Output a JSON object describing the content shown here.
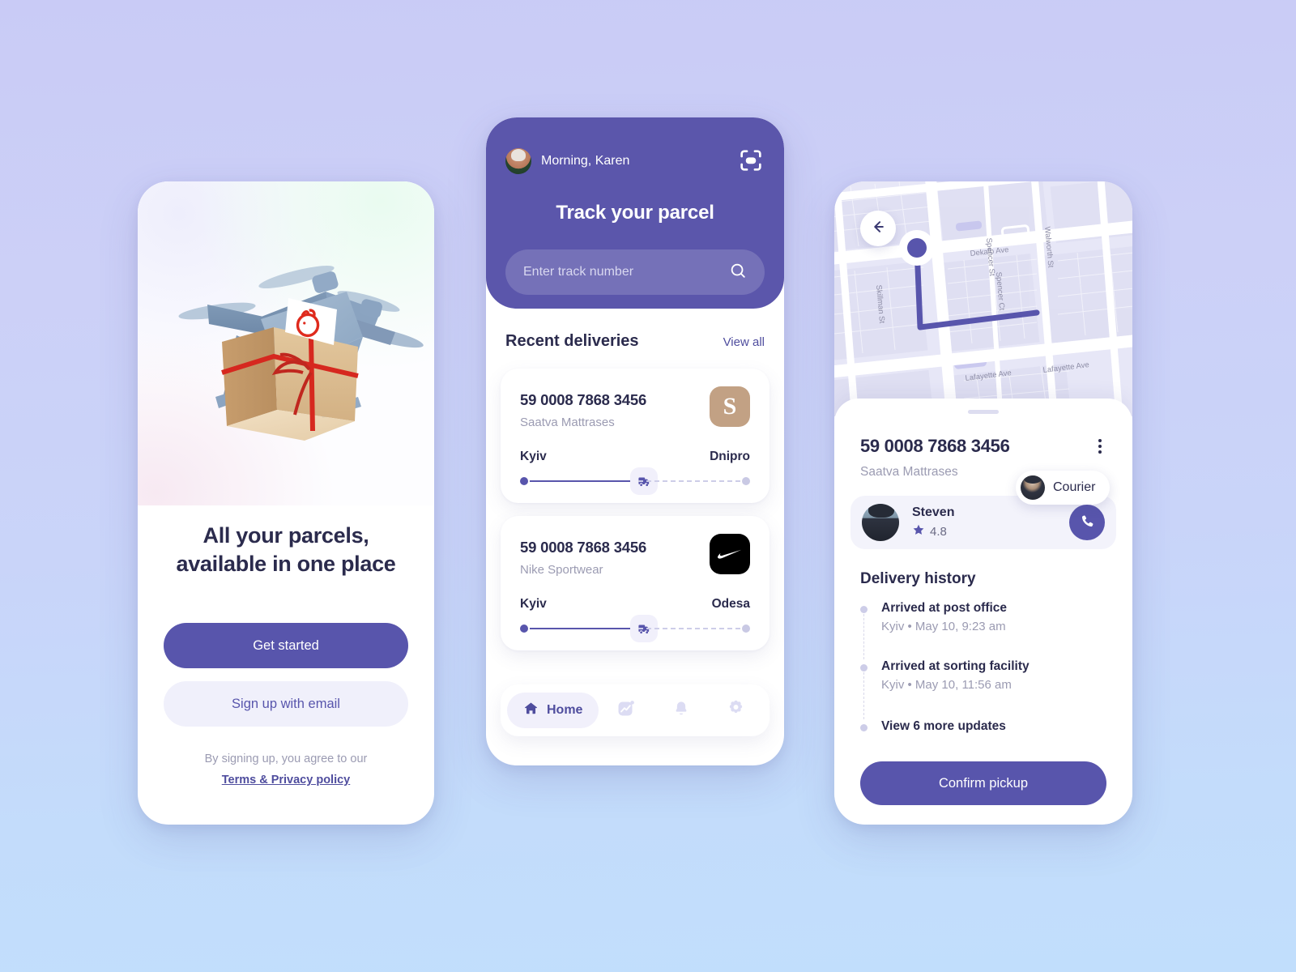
{
  "theme": {
    "accent": "#5855ac",
    "accent_dark": "#4f4d9e",
    "text_dark": "#2b2b4d",
    "text_muted": "#9b9bb2",
    "surface": "#ffffff",
    "surface_tint": "#f1f0fb",
    "bg_top": "#c9cbf6",
    "bg_bottom": "#c1defc"
  },
  "onboarding": {
    "illustration": "drone-carrying-parcel-illustration",
    "title_line1": "All your parcels,",
    "title_line2": "available in one place",
    "primary_button": "Get started",
    "secondary_button": "Sign up with email",
    "legal_prefix": "By signing up, you agree to our",
    "legal_link": "Terms & Privacy policy"
  },
  "home": {
    "greeting": "Morning, Karen",
    "avatar": "user-avatar-karen",
    "scan_icon": "scan-icon",
    "heading": "Track your parcel",
    "search": {
      "placeholder": "Enter track number",
      "value": "",
      "icon": "search-icon"
    },
    "section_title": "Recent deliveries",
    "view_all": "View all",
    "deliveries": [
      {
        "tracking_number": "59 0008 7868 3456",
        "merchant": "Saatva Mattrases",
        "logo_text": "S",
        "logo_name": "saatva-logo",
        "logo_color": "#c2a184",
        "origin": "Kyiv",
        "destination": "Dnipro",
        "progress_percent": 45,
        "transit_icon": "truck-icon"
      },
      {
        "tracking_number": "59 0008 7868 3456",
        "merchant": "Nike Sportwear",
        "logo_text": "",
        "logo_name": "nike-logo",
        "logo_color": "#000000",
        "origin": "Kyiv",
        "destination": "Odesa",
        "progress_percent": 45,
        "transit_icon": "truck-icon"
      }
    ],
    "nav": [
      {
        "label": "Home",
        "icon": "home-icon",
        "active": true
      },
      {
        "label": "",
        "icon": "analytics-icon",
        "active": false,
        "badge": true
      },
      {
        "label": "",
        "icon": "bell-icon",
        "active": false
      },
      {
        "label": "",
        "icon": "gear-icon",
        "active": false
      }
    ]
  },
  "tracking": {
    "back_icon": "arrow-left-icon",
    "map": {
      "streets": [
        "Spencer St",
        "Walworth St",
        "Dekalb Ave",
        "Spencer Ct",
        "Skillman St",
        "Lafayette Ave",
        "Lafayette Ave"
      ],
      "courier_pill_label": "Courier",
      "courier_pill_avatar": "courier-avatar",
      "destination_marker": "destination-pin"
    },
    "tracking_number": "59 0008 7868 3456",
    "merchant": "Saatva Mattrases",
    "menu_icon": "kebab-menu-icon",
    "courier": {
      "name": "Steven",
      "rating": "4.8",
      "rating_icon": "star-icon",
      "avatar": "courier-avatar",
      "call_icon": "phone-icon"
    },
    "history_title": "Delivery history",
    "history": [
      {
        "event": "Arrived at post office",
        "meta": "Kyiv • May 10, 9:23 am"
      },
      {
        "event": "Arrived at sorting facility",
        "meta": "Kyiv • May 10, 11:56 am"
      }
    ],
    "history_more": "View 6 more updates",
    "confirm_button": "Confirm pickup"
  }
}
